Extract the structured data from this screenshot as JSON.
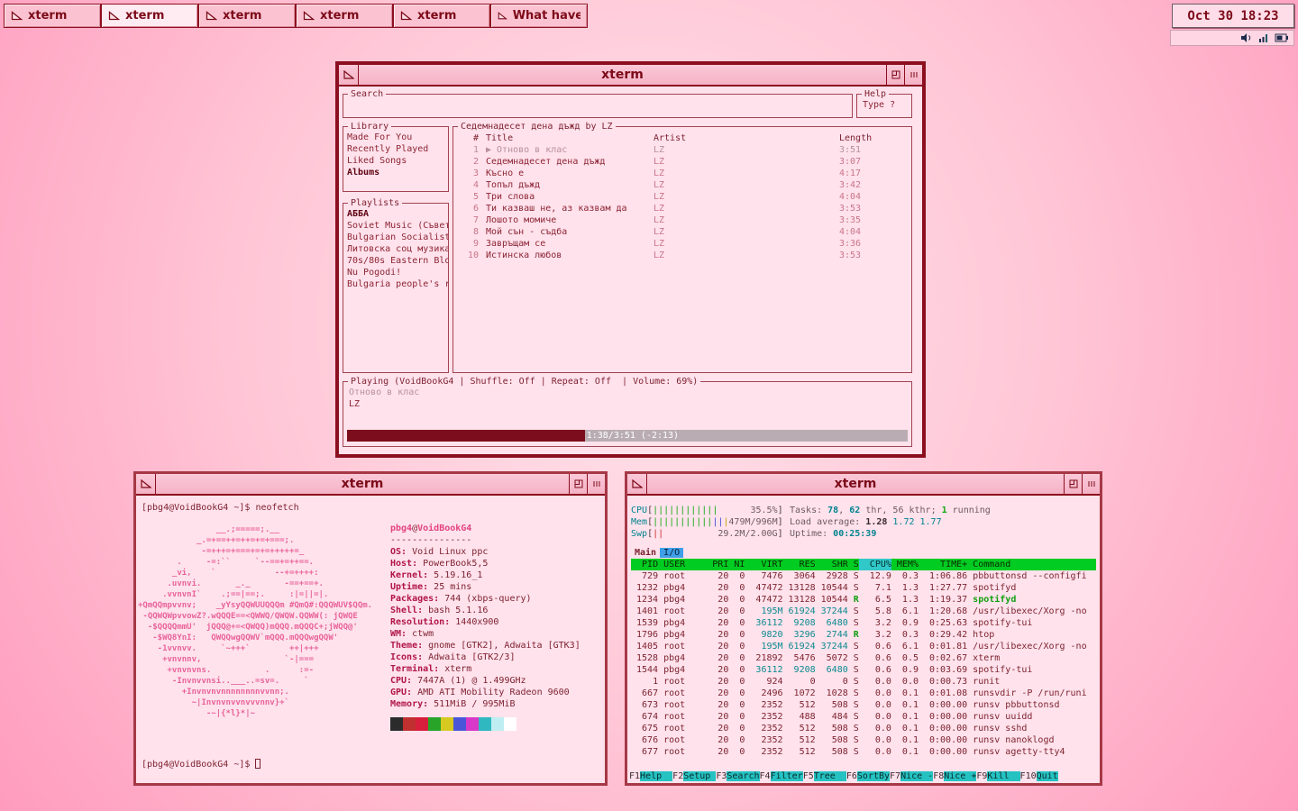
{
  "desktop": {
    "clock": "Oct 30 18:23",
    "taskbar": [
      {
        "label": "xterm",
        "active": false
      },
      {
        "label": "xterm",
        "active": true
      },
      {
        "label": "xterm",
        "active": false
      },
      {
        "label": "xterm",
        "active": false
      },
      {
        "label": "xterm",
        "active": false
      },
      {
        "label": "What have y",
        "active": false
      }
    ]
  },
  "player": {
    "window_title": "xterm",
    "search": {
      "label": "Search",
      "value": ""
    },
    "help": {
      "label": "Help",
      "text": "Type ?"
    },
    "library": {
      "label": "Library",
      "items": [
        "Made For You",
        "Recently Played",
        "Liked Songs",
        "Albums"
      ],
      "selected_index": 3
    },
    "playlists": {
      "label": "Playlists",
      "items": [
        "АББА",
        "Soviet Music (Съвет",
        "Bulgarian Socialist",
        "Литовска соц музика",
        "70s/80s Eastern Blo",
        "Nu Pogodi!",
        "Bulgaria people's r"
      ],
      "selected_index": 0
    },
    "tracklist": {
      "label": "Седемнадесет дена дъжд by LZ",
      "columns": [
        "#",
        "Title",
        "Artist",
        "Length"
      ],
      "play_indicator": "▶",
      "rows": [
        {
          "num": "1",
          "title": "Отново в клас",
          "artist": "LZ",
          "length": "3:51",
          "playing": true
        },
        {
          "num": "2",
          "title": "Седемнадесет дена дъжд",
          "artist": "LZ",
          "length": "3:07",
          "playing": false
        },
        {
          "num": "3",
          "title": "Късно е",
          "artist": "LZ",
          "length": "4:17",
          "playing": false
        },
        {
          "num": "4",
          "title": "Топъл дъжд",
          "artist": "LZ",
          "length": "3:42",
          "playing": false
        },
        {
          "num": "5",
          "title": "Три слова",
          "artist": "LZ",
          "length": "4:04",
          "playing": false
        },
        {
          "num": "6",
          "title": "Ти казваш не, аз казвам да",
          "artist": "LZ",
          "length": "3:53",
          "playing": false
        },
        {
          "num": "7",
          "title": "Лошото момиче",
          "artist": "LZ",
          "length": "3:35",
          "playing": false
        },
        {
          "num": "8",
          "title": "Мой сън - съдба",
          "artist": "LZ",
          "length": "4:04",
          "playing": false
        },
        {
          "num": "9",
          "title": "Завръщам се",
          "artist": "LZ",
          "length": "3:36",
          "playing": false
        },
        {
          "num": "10",
          "title": "Истинска любов",
          "artist": "LZ",
          "length": "3:53",
          "playing": false
        }
      ]
    },
    "playing": {
      "label": "Playing (VoidBookG4 | Shuffle: Off | Repeat: Off  | Volume: 69%)",
      "track": "Отново в клас",
      "artist": "LZ",
      "progress_pct": 42.4,
      "progress_text": "1:38/3:51 (-2:13)"
    }
  },
  "neofetch": {
    "window_title": "xterm",
    "prompt": "[pbg4@VoidBookG4 ~]$",
    "command": "neofetch",
    "user": "pbg4",
    "at": "@",
    "host": "VoidBookG4",
    "separator": "---------------",
    "ascii_art": [
      "                __.;=====;.__",
      "            _.=+==++=++=+=+===;.",
      "             -=+++=+===+=+=+++++=_",
      "        .     -=:``     `--==+=++==.",
      "       _vi,    `            --+=++++:",
      "      .uvnvi.       _._       -==+==+.",
      "     .vvnvnI`    .;==|==;.     :|=||=|.",
      "+QmQQmpvvnv;    _yYsyQQWUUQQQm #QmQ#:QQQWUV$QQm.",
      " -QQWQWpvvowZ?.wQQQE==<QWWQ/QWQW.QQWW(: jQWQE",
      "  -$QQQQmmU'  jQQQ@+=<QWQQ)mQQQ.mQQQC+;jWQQ@'",
      "   -$WQ8YnI:   QWQQwgQQWV`mQQQ.mQQQwgQQW'",
      "    -1vvnvv.     `~+++`        ++|+++",
      "     +vnvnnv,                 `-|===",
      "      +vnvnvns.           .      :=-",
      "       -Invnvvnsi..___..=sv=.     `",
      "         +Invnvnvnnnnnnnnvvnn;.",
      "           ~|Invnvnvvnvvvnnv}+`",
      "              -~|{*l}*|~"
    ],
    "info": [
      {
        "label": "OS",
        "value": "Void Linux ppc"
      },
      {
        "label": "Host",
        "value": "PowerBook5,5"
      },
      {
        "label": "Kernel",
        "value": "5.19.16_1"
      },
      {
        "label": "Uptime",
        "value": "25 mins"
      },
      {
        "label": "Packages",
        "value": "744 (xbps-query)"
      },
      {
        "label": "Shell",
        "value": "bash 5.1.16"
      },
      {
        "label": "Resolution",
        "value": "1440x900"
      },
      {
        "label": "WM",
        "value": "ctwm"
      },
      {
        "label": "Theme",
        "value": "gnome [GTK2], Adwaita [GTK3]"
      },
      {
        "label": "Icons",
        "value": "Adwaita [GTK2/3]"
      },
      {
        "label": "Terminal",
        "value": "xterm"
      },
      {
        "label": "CPU",
        "value": "7447A (1) @ 1.499GHz"
      },
      {
        "label": "GPU",
        "value": "AMD ATI Mobility Radeon 9600"
      },
      {
        "label": "Memory",
        "value": "511MiB / 995MiB"
      }
    ],
    "palette": [
      "#2b2b2b",
      "#c03030",
      "#d81e3c",
      "#28a428",
      "#d6c920",
      "#4956d8",
      "#d838c8",
      "#30b8c0",
      "#bfeef2",
      "#ffffff"
    ]
  },
  "htop": {
    "window_title": "xterm",
    "meters": [
      {
        "left": [
          {
            "t": "CPU",
            "c": "teal"
          },
          {
            "t": "[",
            "c": "dark"
          },
          {
            "t": "||||||||||||",
            "c": "green"
          },
          {
            "t": "      35.5%",
            "c": "gray"
          },
          {
            "t": "]",
            "c": "dark"
          }
        ],
        "right": [
          {
            "t": "Tasks: ",
            "c": "gray"
          },
          {
            "t": "78",
            "c": "tealb"
          },
          {
            "t": ", ",
            "c": "gray"
          },
          {
            "t": "62",
            "c": "tealb"
          },
          {
            "t": " thr, 56 kthr; ",
            "c": "gray"
          },
          {
            "t": "1",
            "c": "greenb"
          },
          {
            "t": " running",
            "c": "gray"
          }
        ]
      },
      {
        "left": [
          {
            "t": "Mem",
            "c": "teal"
          },
          {
            "t": "[",
            "c": "dark"
          },
          {
            "t": "|||||||||||",
            "c": "green"
          },
          {
            "t": "||",
            "c": "blue"
          },
          {
            "t": "|",
            "c": "yellow"
          },
          {
            "t": "479M/996M",
            "c": "gray"
          },
          {
            "t": "]",
            "c": "dark"
          }
        ],
        "right": [
          {
            "t": "Load average: ",
            "c": "gray"
          },
          {
            "t": "1.28 ",
            "c": "darkb"
          },
          {
            "t": "1.72 1.77",
            "c": "teal"
          }
        ]
      },
      {
        "left": [
          {
            "t": "Swp",
            "c": "teal"
          },
          {
            "t": "[",
            "c": "dark"
          },
          {
            "t": "||",
            "c": "red"
          },
          {
            "t": "          29.2M/2.00G",
            "c": "gray"
          },
          {
            "t": "]",
            "c": "dark"
          }
        ],
        "right": [
          {
            "t": "Uptime: ",
            "c": "gray"
          },
          {
            "t": "00:25:39",
            "c": "tealb"
          }
        ]
      }
    ],
    "tabs": [
      {
        "label": "Main",
        "active": true
      },
      {
        "label": "I/O",
        "active": false
      }
    ],
    "columns": [
      "PID",
      "USER",
      "PRI",
      "NI",
      "VIRT",
      "RES",
      "SHR",
      "S",
      "CPU%",
      "MEM%",
      "TIME+",
      "Command"
    ],
    "sort_column": "CPU%",
    "rows": [
      {
        "pid": "729",
        "user": "root",
        "pri": "20",
        "ni": "0",
        "virt": "7476",
        "res": "3064",
        "shr": "2928",
        "s": "S",
        "cpu": "12.9",
        "mem": "0.3",
        "time": "1:06.86",
        "cmd": "pbbuttonsd --configfi"
      },
      {
        "pid": "1232",
        "user": "pbg4",
        "pri": "20",
        "ni": "0",
        "virt": "47472",
        "res": "13128",
        "shr": "10544",
        "s": "S",
        "cpu": "7.1",
        "mem": "1.3",
        "time": "1:27.77",
        "cmd": "spotifyd"
      },
      {
        "pid": "1234",
        "user": "pbg4",
        "pri": "20",
        "ni": "0",
        "virt": "47472",
        "res": "13128",
        "shr": "10544",
        "s": "R",
        "cpu": "6.5",
        "mem": "1.3",
        "time": "1:19.37",
        "cmd": "spotifyd",
        "green_cmd": true
      },
      {
        "pid": "1401",
        "user": "root",
        "pri": "20",
        "ni": "0",
        "virt": "195M",
        "res": "61924",
        "shr": "37244",
        "s": "S",
        "cpu": "5.8",
        "mem": "6.1",
        "time": "1:20.68",
        "cmd": "/usr/libexec/Xorg -no",
        "hl_mem": true
      },
      {
        "pid": "1539",
        "user": "pbg4",
        "pri": "20",
        "ni": "0",
        "virt": "36112",
        "res": "9208",
        "shr": "6480",
        "s": "S",
        "cpu": "3.2",
        "mem": "0.9",
        "time": "0:25.63",
        "cmd": "spotify-tui",
        "hl_mem": true
      },
      {
        "pid": "1796",
        "user": "pbg4",
        "pri": "20",
        "ni": "0",
        "virt": "9820",
        "res": "3296",
        "shr": "2744",
        "s": "R",
        "cpu": "3.2",
        "mem": "0.3",
        "time": "0:29.42",
        "cmd": "htop",
        "hl_mem": true
      },
      {
        "pid": "1405",
        "user": "root",
        "pri": "20",
        "ni": "0",
        "virt": "195M",
        "res": "61924",
        "shr": "37244",
        "s": "S",
        "cpu": "0.6",
        "mem": "6.1",
        "time": "0:01.81",
        "cmd": "/usr/libexec/Xorg -no",
        "hl_mem": true
      },
      {
        "pid": "1528",
        "user": "pbg4",
        "pri": "20",
        "ni": "0",
        "virt": "21892",
        "res": "5476",
        "shr": "5072",
        "s": "S",
        "cpu": "0.6",
        "mem": "0.5",
        "time": "0:02.67",
        "cmd": "xterm"
      },
      {
        "pid": "1544",
        "user": "pbg4",
        "pri": "20",
        "ni": "0",
        "virt": "36112",
        "res": "9208",
        "shr": "6480",
        "s": "S",
        "cpu": "0.6",
        "mem": "0.9",
        "time": "0:03.69",
        "cmd": "spotify-tui",
        "hl_mem": true
      },
      {
        "pid": "1",
        "user": "root",
        "pri": "20",
        "ni": "0",
        "virt": "924",
        "res": "0",
        "shr": "0",
        "s": "S",
        "cpu": "0.0",
        "mem": "0.0",
        "time": "0:00.73",
        "cmd": "runit"
      },
      {
        "pid": "667",
        "user": "root",
        "pri": "20",
        "ni": "0",
        "virt": "2496",
        "res": "1072",
        "shr": "1028",
        "s": "S",
        "cpu": "0.0",
        "mem": "0.1",
        "time": "0:01.08",
        "cmd": "runsvdir -P /run/runi"
      },
      {
        "pid": "673",
        "user": "root",
        "pri": "20",
        "ni": "0",
        "virt": "2352",
        "res": "512",
        "shr": "508",
        "s": "S",
        "cpu": "0.0",
        "mem": "0.1",
        "time": "0:00.00",
        "cmd": "runsv pbbuttonsd"
      },
      {
        "pid": "674",
        "user": "root",
        "pri": "20",
        "ni": "0",
        "virt": "2352",
        "res": "488",
        "shr": "484",
        "s": "S",
        "cpu": "0.0",
        "mem": "0.1",
        "time": "0:00.00",
        "cmd": "runsv uuidd"
      },
      {
        "pid": "675",
        "user": "root",
        "pri": "20",
        "ni": "0",
        "virt": "2352",
        "res": "512",
        "shr": "508",
        "s": "S",
        "cpu": "0.0",
        "mem": "0.1",
        "time": "0:00.00",
        "cmd": "runsv sshd"
      },
      {
        "pid": "676",
        "user": "root",
        "pri": "20",
        "ni": "0",
        "virt": "2352",
        "res": "512",
        "shr": "508",
        "s": "S",
        "cpu": "0.0",
        "mem": "0.1",
        "time": "0:00.00",
        "cmd": "runsv nanoklogd"
      },
      {
        "pid": "677",
        "user": "root",
        "pri": "20",
        "ni": "0",
        "virt": "2352",
        "res": "512",
        "shr": "508",
        "s": "S",
        "cpu": "0.0",
        "mem": "0.1",
        "time": "0:00.00",
        "cmd": "runsv agetty-tty4"
      }
    ],
    "fkeys": [
      {
        "key": "F1",
        "label": "Help  "
      },
      {
        "key": "F2",
        "label": "Setup "
      },
      {
        "key": "F3",
        "label": "Search"
      },
      {
        "key": "F4",
        "label": "Filter"
      },
      {
        "key": "F5",
        "label": "Tree  "
      },
      {
        "key": "F6",
        "label": "SortBy"
      },
      {
        "key": "F7",
        "label": "Nice -"
      },
      {
        "key": "F8",
        "label": "Nice +"
      },
      {
        "key": "F9",
        "label": "Kill  "
      },
      {
        "key": "F10",
        "label": "Quit"
      }
    ]
  }
}
